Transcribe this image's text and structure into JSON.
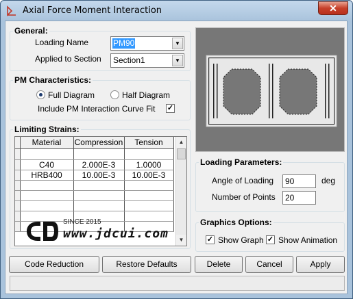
{
  "window": {
    "title": "Axial Force Moment Interaction",
    "close_label": "✕"
  },
  "general": {
    "legend": "General:",
    "loading_name_label": "Loading Name",
    "loading_name_value": "PM90",
    "applied_to_label": "Applied to Section",
    "applied_to_value": "Section1"
  },
  "pm": {
    "legend": "PM Characteristics:",
    "full_label": "Full Diagram",
    "half_label": "Half Diagram",
    "selected": "Full Diagram",
    "curve_fit_label": "Include PM Interaction Curve Fit",
    "curve_fit_checked": true
  },
  "strains": {
    "legend": "Limiting Strains:",
    "columns": [
      "Material",
      "Compression",
      "Tension"
    ],
    "rows": [
      [
        "",
        "",
        ""
      ],
      [
        "C40",
        "2.000E-3",
        "1.0000"
      ],
      [
        "HRB400",
        "10.00E-3",
        "10.00E-3"
      ],
      [
        "",
        "",
        ""
      ],
      [
        "",
        "",
        ""
      ],
      [
        "",
        "",
        ""
      ],
      [
        "",
        "",
        ""
      ],
      [
        "",
        "",
        ""
      ]
    ]
  },
  "watermark": {
    "since": "SINCE 2015",
    "url": "www.jdcui.com"
  },
  "loading": {
    "legend": "Loading Parameters:",
    "angle_label": "Angle of Loading",
    "angle_value": "90",
    "angle_unit": "deg",
    "points_label": "Number of Points",
    "points_value": "20"
  },
  "graphics": {
    "legend": "Graphics Options:",
    "show_graph_label": "Show Graph",
    "show_graph_checked": true,
    "show_anim_label": "Show Animation",
    "show_anim_checked": true
  },
  "buttons": {
    "code_reduction": "Code Reduction",
    "restore_defaults": "Restore Defaults",
    "delete": "Delete",
    "cancel": "Cancel",
    "apply": "Apply"
  }
}
